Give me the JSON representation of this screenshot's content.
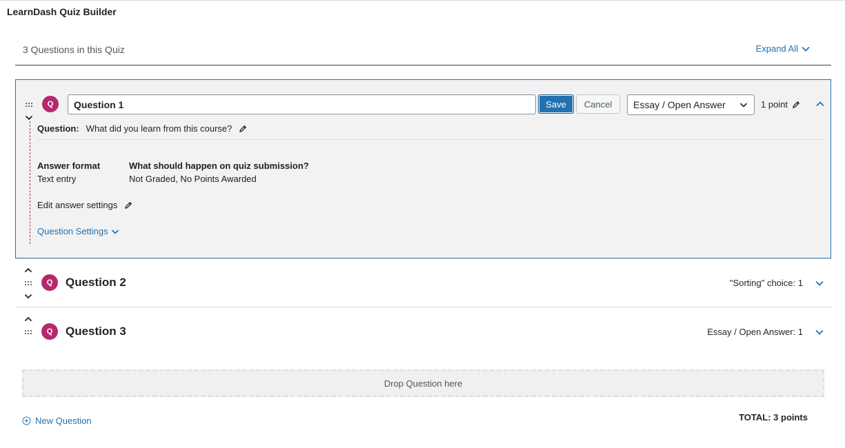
{
  "app": {
    "title": "LearnDash Quiz Builder"
  },
  "summary": {
    "count_text": "3 Questions in this Quiz",
    "expand_all_label": "Expand All"
  },
  "question1": {
    "badge": "Q",
    "title_value": "Question 1",
    "save_label": "Save",
    "cancel_label": "Cancel",
    "type_selected": "Essay / Open Answer",
    "points_label": "1 point",
    "question_label": "Question:",
    "question_text": "What did you learn from this course?",
    "answer_format_label": "Answer format",
    "answer_format_value": "Text entry",
    "submission_label": "What should happen on quiz submission?",
    "submission_value": "Not Graded, No Points Awarded",
    "edit_answer_label": "Edit answer settings",
    "settings_label": "Question Settings"
  },
  "question2": {
    "badge": "Q",
    "title": "Question 2",
    "meta": "\"Sorting\" choice: 1"
  },
  "question3": {
    "badge": "Q",
    "title": "Question 3",
    "meta": "Essay / Open Answer: 1"
  },
  "drop_zone": {
    "label": "Drop Question here"
  },
  "footer": {
    "new_question_label": "New Question",
    "total_label": "TOTAL: 3 points"
  },
  "colors": {
    "accent": "#2271b1",
    "badge": "#b5286e",
    "panel_bg": "#f2f2f2"
  },
  "icons": [
    "chevron-down-icon",
    "chevron-up-icon",
    "drag-handle-icon",
    "pencil-icon",
    "plus-circle-icon"
  ]
}
